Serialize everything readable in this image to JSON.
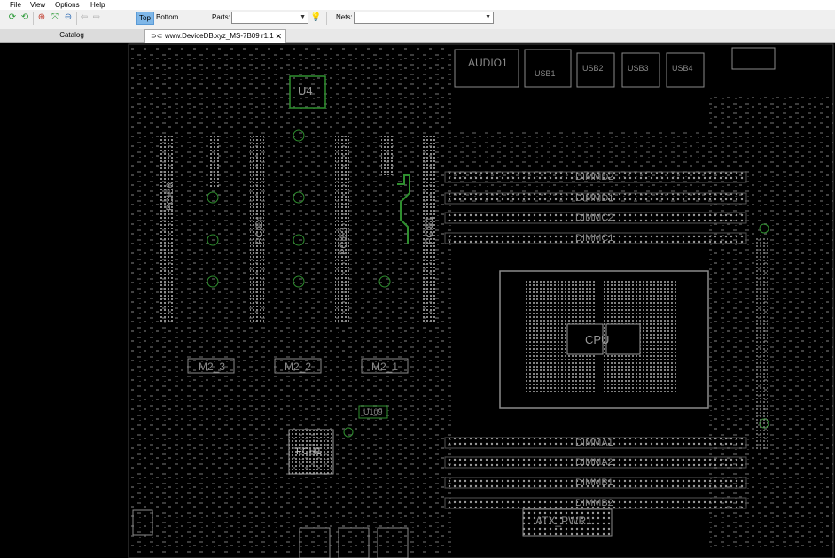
{
  "menu": {
    "file": "File",
    "view": "View",
    "options": "Options",
    "help": "Help"
  },
  "toolbar": {
    "icons": [
      "refresh-icon",
      "reload-icon",
      "zoom-in-icon",
      "fit-icon",
      "zoom-out-icon",
      "back-icon",
      "forward-icon"
    ],
    "top_label": "Top",
    "bottom_label": "Bottom",
    "parts_label": "Parts:",
    "parts_value": "",
    "nets_label": "Nets:",
    "nets_value": "",
    "active_side": "Top"
  },
  "tabs": {
    "catalog": "Catalog",
    "document": "www.DeviceDB.xyz_MS-7B09 r1.1"
  },
  "board": {
    "labels": {
      "u4": "U4",
      "audio": "AUDIO1",
      "usb": "USB1",
      "usb2": "USB2",
      "usb3": "USB3",
      "usb4": "USB4",
      "dimmd2": "DIMMD2",
      "dimmd1": "DIMMD1",
      "dimmc2": "DIMMC2",
      "dimmc1": "DIMMC1",
      "pcie6": "PCIE6",
      "pcie4": "PCIE4",
      "pcie3": "PCIE3",
      "pcie1": "PCIE1",
      "cpu": "CPU",
      "m2_3": "M2_3",
      "m2_2": "M2_2",
      "m2_1": "M2_1",
      "u109": "U109",
      "fch": "FCH1",
      "dimma1": "DIMMA1",
      "dimma2": "DIMMA2",
      "dimmb1": "DIMMB1",
      "dimmb2": "DIMMB2",
      "atx": "ATX_PWR1"
    },
    "colors": {
      "background": "#000000",
      "trace": "#2f8f2f",
      "outline": "#8a8a8a",
      "pad": "#9a9a9a"
    }
  }
}
